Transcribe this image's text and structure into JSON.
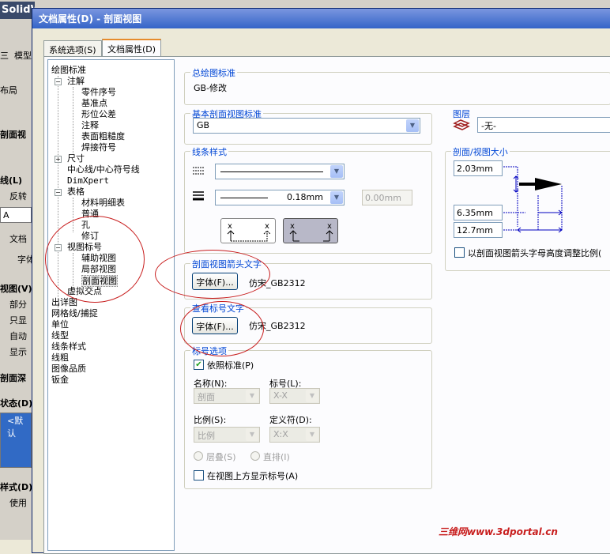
{
  "background_app": {
    "logo": "SolidW",
    "left_panel": [
      "三",
      "模型",
      "布局",
      "剖面视",
      "线(L)",
      "反转",
      "A",
      "文档",
      "字体",
      "视图(V)",
      "部分",
      "只显",
      "自动",
      "显示",
      "剖面深",
      "状态(D)",
      "<默认",
      "样式(D)",
      "使用"
    ]
  },
  "dialog": {
    "title": "文档属性(D) - 剖面视图",
    "tabs": [
      "系统选项(S)",
      "文档属性(D)"
    ],
    "active_tab": 1,
    "tree": {
      "root": "绘图标准",
      "items": [
        {
          "label": "注解",
          "level": 1,
          "expander": "−"
        },
        {
          "label": "零件序号",
          "level": 2
        },
        {
          "label": "基准点",
          "level": 2
        },
        {
          "label": "形位公差",
          "level": 2
        },
        {
          "label": "注释",
          "level": 2
        },
        {
          "label": "表面粗糙度",
          "level": 2
        },
        {
          "label": "焊接符号",
          "level": 2
        },
        {
          "label": "尺寸",
          "level": 1,
          "expander": "+"
        },
        {
          "label": "中心线/中心符号线",
          "level": 1
        },
        {
          "label": "DimXpert",
          "level": 1
        },
        {
          "label": "表格",
          "level": 1,
          "expander": "−"
        },
        {
          "label": "材料明细表",
          "level": 2
        },
        {
          "label": "普通",
          "level": 2
        },
        {
          "label": "孔",
          "level": 2
        },
        {
          "label": "修订",
          "level": 2
        },
        {
          "label": "视图标号",
          "level": 1,
          "expander": "−"
        },
        {
          "label": "辅助视图",
          "level": 2
        },
        {
          "label": "局部视图",
          "level": 2
        },
        {
          "label": "剖面视图",
          "level": 2,
          "selected": true
        },
        {
          "label": "虚拟交点",
          "level": 1
        },
        {
          "label": "出详图",
          "level": 0
        },
        {
          "label": "网格线/捕捉",
          "level": 0
        },
        {
          "label": "单位",
          "level": 0
        },
        {
          "label": "线型",
          "level": 0
        },
        {
          "label": "线条样式",
          "level": 0
        },
        {
          "label": "线粗",
          "level": 0
        },
        {
          "label": "图像品质",
          "level": 0
        },
        {
          "label": "钣金",
          "level": 0
        }
      ]
    },
    "overall_standard": {
      "label": "总绘图标准",
      "value": "GB-修改"
    },
    "base_standard": {
      "label": "基本剖面视图标准",
      "value": "GB"
    },
    "layer": {
      "label": "图层",
      "value": "-无-"
    },
    "line_style": {
      "label": "线条样式",
      "thickness": "0.18mm",
      "custom": "0.00mm"
    },
    "section_size": {
      "label": "剖面/视图大小",
      "v1": "2.03mm",
      "v2": "6.35mm",
      "v3": "12.7mm",
      "scale_checkbox": "以剖面视图箭头字母高度调整比例(",
      "scale_checked": false
    },
    "arrow_text": {
      "label": "剖面视图箭头文字",
      "button": "字体(F)...",
      "font": "仿宋_GB2312"
    },
    "label_text": {
      "label": "查看标号文字",
      "button": "字体(F)...",
      "font": "仿宋_GB2312"
    },
    "label_options": {
      "label": "标号选项",
      "per_standard": "依照标准(P)",
      "per_standard_checked": true,
      "name_label": "名称(N):",
      "name_value": "剖面",
      "mark_label": "标号(L):",
      "mark_value": "X-X",
      "scale_label": "比例(S):",
      "scale_value": "比例",
      "delim_label": "定义符(D):",
      "delim_value": "X:X",
      "stacked": "层叠(S)",
      "inline": "直排(I)",
      "show_above": "在视图上方显示标号(A)",
      "show_above_checked": false
    }
  },
  "watermark": "三维网www.3dportal.cn",
  "colors": {
    "title_bar": "#3464c8",
    "group_label": "#0046d5",
    "annotation": "#c81e1e",
    "tab_highlight": "#e68b2c"
  }
}
